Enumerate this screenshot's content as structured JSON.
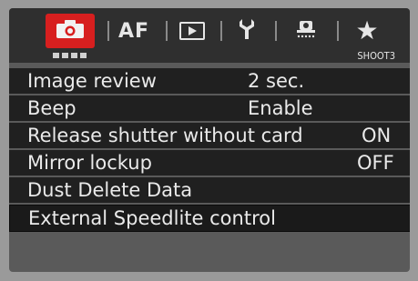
{
  "tabs": [
    {
      "name": "camera",
      "label": "",
      "icon": "camera-icon",
      "active": true
    },
    {
      "name": "af",
      "label": "AF",
      "icon": "",
      "active": false
    },
    {
      "name": "playback",
      "label": "",
      "icon": "playback-icon",
      "active": false
    },
    {
      "name": "setup",
      "label": "",
      "icon": "wrench-icon",
      "active": false
    },
    {
      "name": "custom",
      "label": "",
      "icon": "custom-functions-icon",
      "active": false
    },
    {
      "name": "my-menu",
      "label": "★",
      "icon": "star-icon",
      "active": false
    }
  ],
  "subheader": {
    "page_name": "SHOOT3",
    "page_indicator_dots": 4
  },
  "menu": {
    "items": [
      {
        "label": "Image review",
        "value": "2 sec."
      },
      {
        "label": "Beep",
        "value": "Enable"
      },
      {
        "label": "Release shutter without card",
        "value": "ON"
      },
      {
        "label": "Mirror lockup",
        "value": "OFF"
      },
      {
        "label": "Dust Delete Data",
        "value": ""
      },
      {
        "label": "External Speedlite control",
        "value": ""
      }
    ],
    "selected_index": 5
  },
  "colors": {
    "active_tab": "#d71f1f",
    "menu_bg": "#202020",
    "text": "#eaeaea"
  }
}
